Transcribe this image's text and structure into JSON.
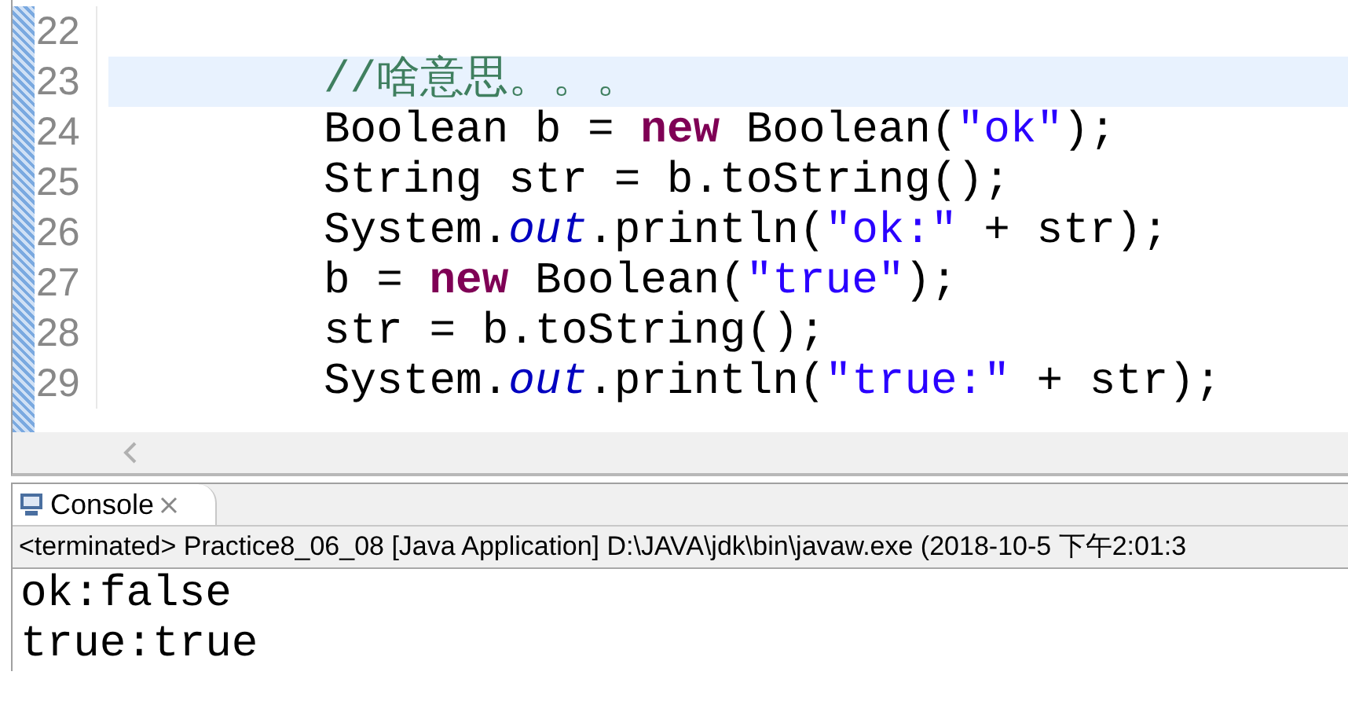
{
  "editor": {
    "lines": [
      {
        "number": "22",
        "selected": false
      },
      {
        "number": "23",
        "selected": true,
        "tokens": [
          {
            "kind": "comment",
            "text": "//啥意思。。。"
          }
        ]
      },
      {
        "number": "24",
        "selected": false,
        "tokens": [
          {
            "kind": "plain",
            "text": "Boolean b = "
          },
          {
            "kind": "keyword",
            "text": "new"
          },
          {
            "kind": "plain",
            "text": " Boolean("
          },
          {
            "kind": "string",
            "text": "\"ok\""
          },
          {
            "kind": "plain",
            "text": ");"
          }
        ]
      },
      {
        "number": "25",
        "selected": false,
        "tokens": [
          {
            "kind": "plain",
            "text": "String str = b.toString();"
          }
        ]
      },
      {
        "number": "26",
        "selected": false,
        "tokens": [
          {
            "kind": "plain",
            "text": "System."
          },
          {
            "kind": "field",
            "text": "out"
          },
          {
            "kind": "plain",
            "text": ".println("
          },
          {
            "kind": "string",
            "text": "\"ok:\""
          },
          {
            "kind": "plain",
            "text": " + str);"
          }
        ]
      },
      {
        "number": "27",
        "selected": false,
        "tokens": [
          {
            "kind": "plain",
            "text": "b = "
          },
          {
            "kind": "keyword",
            "text": "new"
          },
          {
            "kind": "plain",
            "text": " Boolean("
          },
          {
            "kind": "string",
            "text": "\"true\""
          },
          {
            "kind": "plain",
            "text": ");"
          }
        ]
      },
      {
        "number": "28",
        "selected": false,
        "tokens": [
          {
            "kind": "plain",
            "text": "str = b.toString();"
          }
        ]
      },
      {
        "number": "29",
        "selected": false,
        "tokens": [
          {
            "kind": "plain",
            "text": "System."
          },
          {
            "kind": "field",
            "text": "out"
          },
          {
            "kind": "plain",
            "text": ".println("
          },
          {
            "kind": "string",
            "text": "\"true:\""
          },
          {
            "kind": "plain",
            "text": " + str);"
          }
        ]
      }
    ]
  },
  "console": {
    "tab": {
      "label": "Console"
    },
    "status": "<terminated> Practice8_06_08 [Java Application] D:\\JAVA\\jdk\\bin\\javaw.exe (2018-10-5 下午2:01:3",
    "output": [
      "ok:false",
      "true:true"
    ]
  }
}
